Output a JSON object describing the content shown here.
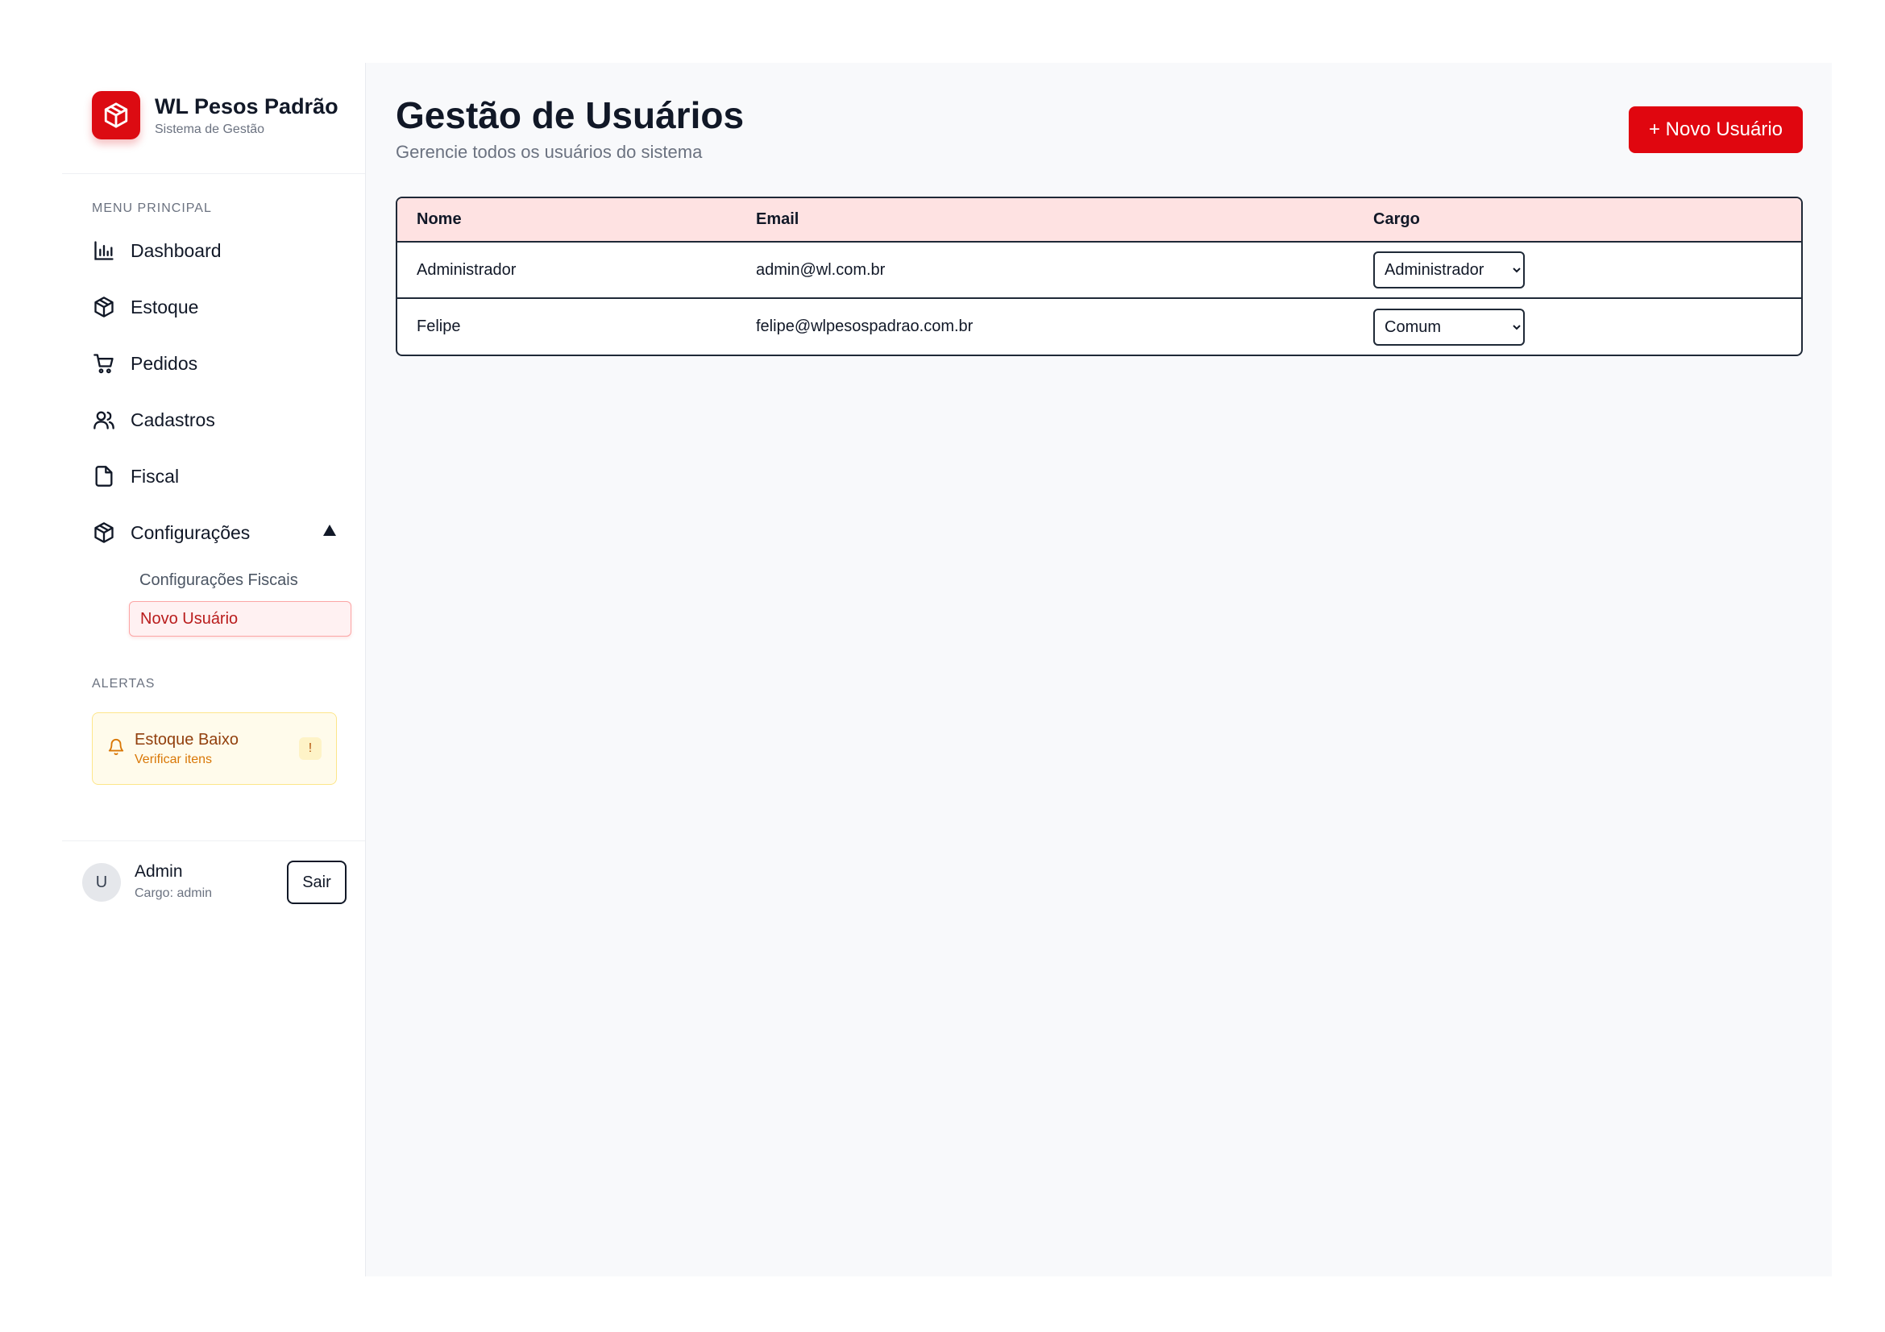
{
  "brand": {
    "name": "WL Pesos Padrão",
    "subtitle": "Sistema de Gestão"
  },
  "sidebar": {
    "menu_label": "MENU PRINCIPAL",
    "items": [
      {
        "label": "Dashboard",
        "icon": "bar-chart-icon"
      },
      {
        "label": "Estoque",
        "icon": "box-icon"
      },
      {
        "label": "Pedidos",
        "icon": "shopping-cart-icon"
      },
      {
        "label": "Cadastros",
        "icon": "users-icon"
      },
      {
        "label": "Fiscal",
        "icon": "file-icon"
      },
      {
        "label": "Configurações",
        "icon": "box-icon",
        "expanded": true
      }
    ],
    "sub_items": [
      {
        "label": "Configurações Fiscais",
        "active": false
      },
      {
        "label": "Novo Usuário",
        "active": true
      }
    ],
    "alerts_label": "ALERTAS",
    "alert": {
      "title": "Estoque Baixo",
      "subtitle": "Verificar itens",
      "badge": "!",
      "icon": "bell-icon"
    }
  },
  "user": {
    "avatar_initial": "U",
    "name": "Admin",
    "role": "Cargo: admin",
    "logout_label": "Sair"
  },
  "main": {
    "title": "Gestão de Usuários",
    "subtitle": "Gerencie todos os usuários do sistema",
    "new_user_button": "+ Novo Usuário",
    "table": {
      "headers": [
        "Nome",
        "Email",
        "Cargo"
      ],
      "rows": [
        {
          "nome": "Administrador",
          "email": "admin@wl.com.br",
          "cargo": "Administrador"
        },
        {
          "nome": "Felipe",
          "email": "felipe@wlpesospadrao.com.br",
          "cargo": "Comum"
        }
      ]
    }
  },
  "colors": {
    "accent": "#e0060f",
    "header_row": "#fee2e2",
    "alert_bg": "#fffbeb"
  }
}
